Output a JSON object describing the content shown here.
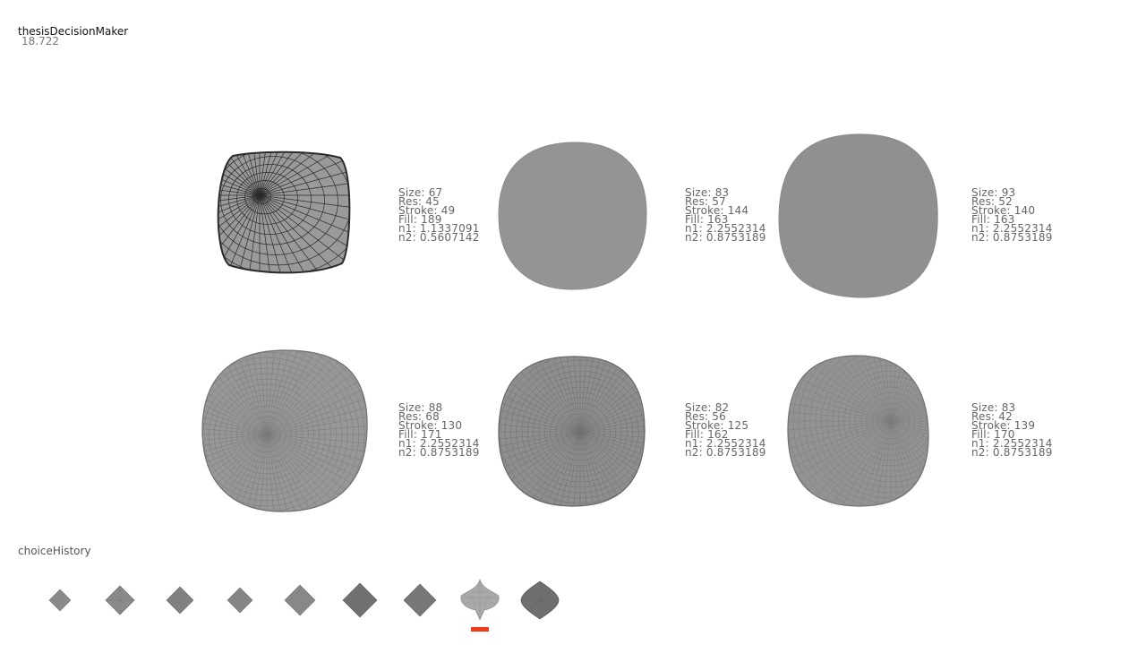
{
  "app": {
    "title": "thesisDecisionMaker",
    "value": "18.722"
  },
  "labels": {
    "size": "Size: ",
    "res": "Res: ",
    "stroke": "Stroke: ",
    "fill": "Fill: ",
    "n1": "n1: ",
    "n2": "n2: "
  },
  "candidates": [
    {
      "size": "67",
      "res": "45",
      "stroke": "49",
      "fill": "189",
      "n1": "1.1337091",
      "n2": "0.5607142"
    },
    {
      "size": "83",
      "res": "57",
      "stroke": "144",
      "fill": "163",
      "n1": "2.2552314",
      "n2": "0.8753189"
    },
    {
      "size": "93",
      "res": "52",
      "stroke": "140",
      "fill": "163",
      "n1": "2.2552314",
      "n2": "0.8753189"
    },
    {
      "size": "88",
      "res": "68",
      "stroke": "130",
      "fill": "171",
      "n1": "2.2552314",
      "n2": "0.8753189"
    },
    {
      "size": "82",
      "res": "56",
      "stroke": "125",
      "fill": "162",
      "n1": "2.2552314",
      "n2": "0.8753189"
    },
    {
      "size": "83",
      "res": "42",
      "stroke": "139",
      "fill": "170",
      "n1": "2.2552314",
      "n2": "0.8753189"
    }
  ],
  "history": {
    "label": "choiceHistory",
    "items": [
      {
        "shape": "diamond-small"
      },
      {
        "shape": "diamond-mesh"
      },
      {
        "shape": "diamond"
      },
      {
        "shape": "diamond"
      },
      {
        "shape": "diamond"
      },
      {
        "shape": "diamond-dark"
      },
      {
        "shape": "diamond-dark"
      },
      {
        "shape": "spiky-mesh",
        "selected": true
      },
      {
        "shape": "rounded-diamond"
      }
    ],
    "selection_color": "#ef3b1a"
  },
  "colors": {
    "shape_fill": "#8f8f8f",
    "mesh_stroke": "#555555",
    "wire_dark": "#2b2b2b"
  }
}
